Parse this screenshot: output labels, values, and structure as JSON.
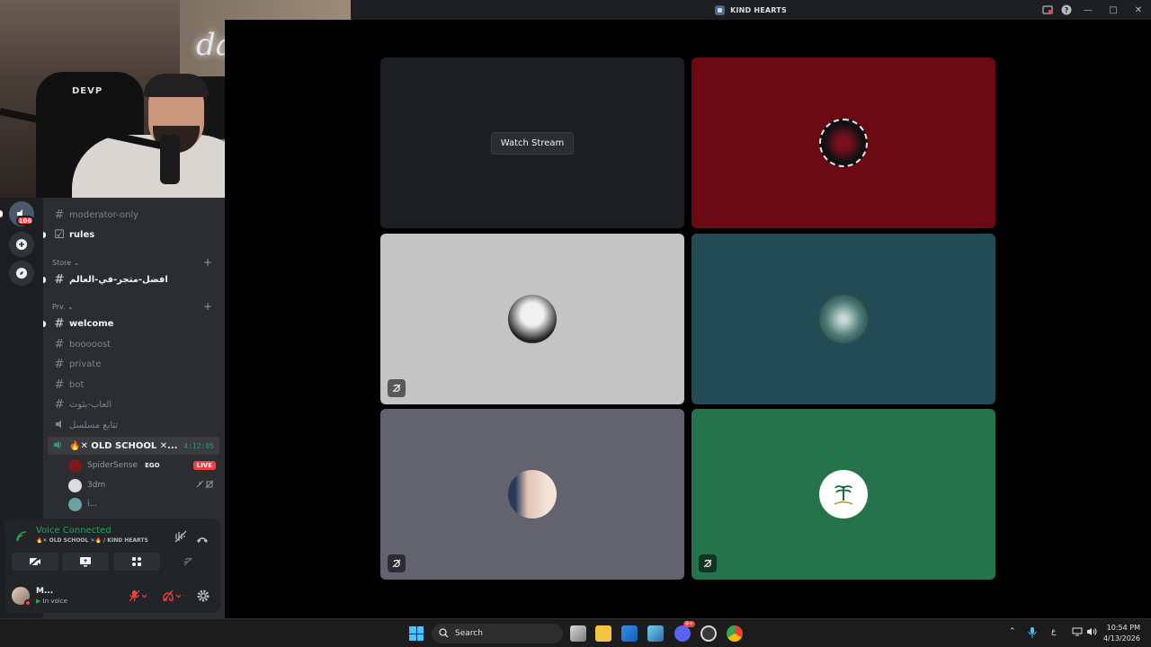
{
  "window": {
    "title": "KIND HEARTS"
  },
  "webcam": {
    "neon_text": "dalaga",
    "chair_text": "DEVP"
  },
  "rail": {
    "badge": "106"
  },
  "sidebar": {
    "channels_top": [
      {
        "name": "moderator-only",
        "unread": false
      },
      {
        "name": "rules",
        "unread": true
      }
    ],
    "category_store": {
      "label": "Store ⌄"
    },
    "store_channels": [
      {
        "name": "افضل-متجر-في-العالم",
        "unread": true
      }
    ],
    "category_prv": {
      "label": "Prv. ⌄"
    },
    "prv_channels": [
      {
        "name": "welcome",
        "unread": true
      },
      {
        "name": "booooost",
        "unread": false
      },
      {
        "name": "private",
        "unread": false
      },
      {
        "name": "bot",
        "unread": false
      },
      {
        "name": "العاب-بثوث",
        "unread": false
      },
      {
        "name": "تتابع مسلسل",
        "unread": false,
        "voice": true
      }
    ],
    "voice_channel": {
      "name": "🔥✕ OLD SCHOOL ✕...",
      "timer": "4:12:05"
    },
    "members": [
      {
        "name": "SpiderSense",
        "tag": "EGO",
        "live": "LIVE",
        "color": "#7a1b1b"
      },
      {
        "name": "3dm",
        "color": "#dcdcdc"
      },
      {
        "name": "i...",
        "color": "#6aa3a0"
      }
    ]
  },
  "voice_panel": {
    "status": "Voice Connected",
    "channel": "🔥✕ OLD SCHOOL ✕🔥 / KIND HEARTS"
  },
  "user": {
    "name": "M...",
    "status": "In voice"
  },
  "stage": {
    "watch_label": "Watch Stream",
    "tiles": [
      {
        "bg": "#1e1f22",
        "type": "stream"
      },
      {
        "bg": "#6b0a12",
        "avatar": "#1a1a1a"
      },
      {
        "bg": "#c4c4c4",
        "avatar": "#e8e8e8",
        "muted": true
      },
      {
        "bg": "#244c55",
        "avatar": "#7fa6a3"
      },
      {
        "bg": "#636370",
        "avatar": "#e0c4b2",
        "muted": true
      },
      {
        "bg": "#24734a",
        "avatar": "#ffffff",
        "muted": true
      }
    ]
  },
  "taskbar": {
    "search_label": "Search",
    "lang": "ع",
    "time": "10:54 PM",
    "date": "4/13/2026",
    "discord_badge": "9+"
  }
}
